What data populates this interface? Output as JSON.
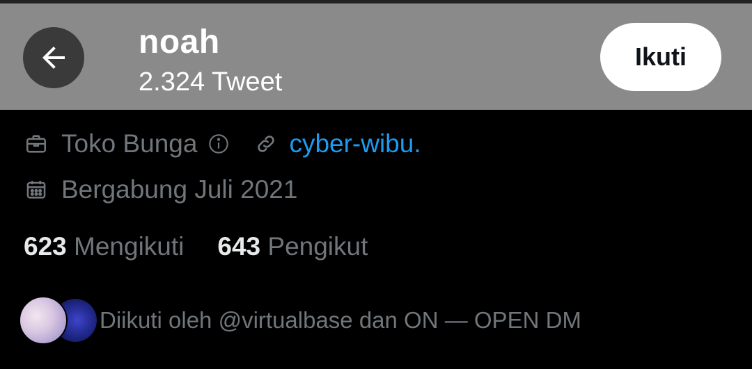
{
  "header": {
    "name": "noah",
    "tweet_count": "2.324 Tweet",
    "follow_label": "Ikuti"
  },
  "profile": {
    "category": "Toko Bunga",
    "link_text": "cyber-wibu.",
    "joined": "Bergabung Juli 2021"
  },
  "stats": {
    "following_count": "623",
    "following_label": "Mengikuti",
    "followers_count": "643",
    "followers_label": "Pengikut"
  },
  "followed_by": {
    "text": "Diikuti oleh @virtualbase dan ON — OPEN DM"
  },
  "colors": {
    "header_bg": "#8a8a8a",
    "link": "#1d9bf0",
    "muted_text": "#71767b",
    "background": "#000000"
  },
  "icons": [
    "back-arrow-icon",
    "briefcase-icon",
    "info-icon",
    "link-icon",
    "calendar-icon"
  ]
}
